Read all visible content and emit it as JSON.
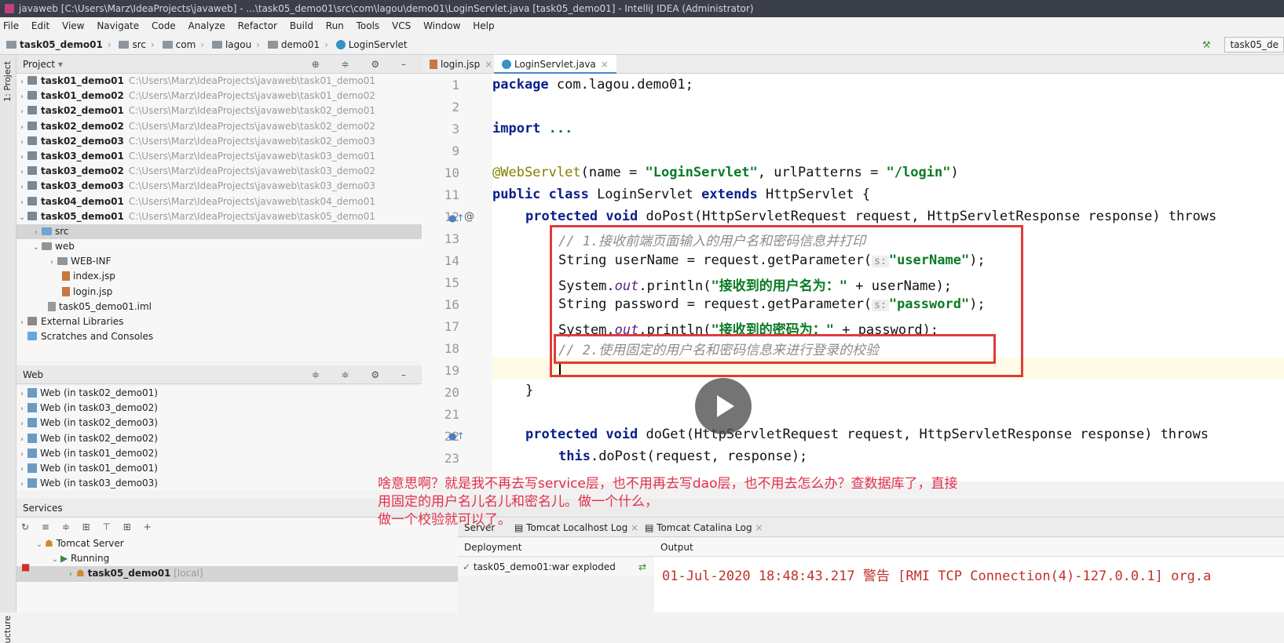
{
  "window": {
    "title": "javaweb [C:\\Users\\Marz\\IdeaProjects\\javaweb] - ...\\task05_demo01\\src\\com\\lagou\\demo01\\LoginServlet.java [task05_demo01] - IntelliJ IDEA (Administrator)"
  },
  "menu": [
    "File",
    "Edit",
    "View",
    "Navigate",
    "Code",
    "Analyze",
    "Refactor",
    "Build",
    "Run",
    "Tools",
    "VCS",
    "Window",
    "Help"
  ],
  "breadcrumbs": [
    "task05_demo01",
    "src",
    "com",
    "lagou",
    "demo01",
    "LoginServlet"
  ],
  "run_config": "task05_de",
  "side_strip": {
    "project": "1: Project",
    "structure": "ucture"
  },
  "project_panel": {
    "title": "Project",
    "modules": [
      {
        "name": "task01_demo01",
        "path": "C:\\Users\\Marz\\IdeaProjects\\javaweb\\task01_demo01"
      },
      {
        "name": "task01_demo02",
        "path": "C:\\Users\\Marz\\IdeaProjects\\javaweb\\task01_demo02"
      },
      {
        "name": "task02_demo01",
        "path": "C:\\Users\\Marz\\IdeaProjects\\javaweb\\task02_demo01"
      },
      {
        "name": "task02_demo02",
        "path": "C:\\Users\\Marz\\IdeaProjects\\javaweb\\task02_demo02"
      },
      {
        "name": "task02_demo03",
        "path": "C:\\Users\\Marz\\IdeaProjects\\javaweb\\task02_demo03"
      },
      {
        "name": "task03_demo01",
        "path": "C:\\Users\\Marz\\IdeaProjects\\javaweb\\task03_demo01"
      },
      {
        "name": "task03_demo02",
        "path": "C:\\Users\\Marz\\IdeaProjects\\javaweb\\task03_demo02"
      },
      {
        "name": "task03_demo03",
        "path": "C:\\Users\\Marz\\IdeaProjects\\javaweb\\task03_demo03"
      },
      {
        "name": "task04_demo01",
        "path": "C:\\Users\\Marz\\IdeaProjects\\javaweb\\task04_demo01"
      },
      {
        "name": "task05_demo01",
        "path": "C:\\Users\\Marz\\IdeaProjects\\javaweb\\task05_demo01"
      }
    ],
    "children": {
      "src": "src",
      "web": "web",
      "webinf": "WEB-INF",
      "index": "index.jsp",
      "login": "login.jsp",
      "iml": "task05_demo01.iml",
      "libs": "External Libraries",
      "scratches": "Scratches and Consoles"
    }
  },
  "web_panel": {
    "title": "Web",
    "items": [
      "Web (in task02_demo01)",
      "Web (in task03_demo02)",
      "Web (in task02_demo03)",
      "Web (in task02_demo02)",
      "Web (in task01_demo02)",
      "Web (in task01_demo01)",
      "Web (in task03_demo03)"
    ]
  },
  "editor": {
    "tabs": [
      {
        "label": "login.jsp"
      },
      {
        "label": "LoginServlet.java"
      }
    ],
    "line_numbers": [
      "1",
      "2",
      "3",
      "9",
      "10",
      "11",
      "12",
      "13",
      "14",
      "15",
      "16",
      "17",
      "18",
      "19",
      "20",
      "21",
      "22",
      "23"
    ],
    "code": {
      "l1_kw": "package",
      "l1_rest": " com.lagou.demo01;",
      "l3_kw": "import",
      "l3_rest": " ...",
      "l10_ann": "@WebServlet",
      "l10_a": "(name = ",
      "l10_s1": "\"LoginServlet\"",
      "l10_b": ", urlPatterns = ",
      "l10_s2": "\"/login\"",
      "l10_c": ")",
      "l11_kw1": "public class",
      "l11_a": " LoginServlet ",
      "l11_kw2": "extends",
      "l11_b": " HttpServlet {",
      "l12_kw": "protected void",
      "l12_rest": " doPost(HttpServletRequest request, HttpServletResponse response) throws",
      "l13_cmt": "// 1.接收前端页面输入的用户名和密码信息并打印",
      "l14_a": "String userName = request.getParameter(",
      "l14_hint": "s:",
      "l14_s": "\"userName\"",
      "l14_b": ");",
      "l15_a": "System.",
      "l15_out": "out",
      "l15_b": ".println(",
      "l15_s": "\"接收到的用户名为：\"",
      "l15_c": " + userName);",
      "l16_a": "String password = request.getParameter(",
      "l16_hint": "s:",
      "l16_s": "\"password\"",
      "l16_b": ");",
      "l17_a": "System.",
      "l17_out": "out",
      "l17_b": ".println(",
      "l17_s": "\"接收到的密码为：\"",
      "l17_c": " + password);",
      "l18_cmt": "// 2.使用固定的用户名和密码信息来进行登录的校验",
      "l20": "}",
      "l22_kw": "protected void",
      "l22_rest": " doGet(HttpServletRequest request, HttpServletResponse response) throws",
      "l23_kw": "this",
      "l23_rest": ".doPost(request, response);"
    }
  },
  "subtitle": {
    "line1": "啥意思啊？就是我不再去写service层，也不用再去写dao层，也不用去怎么办？查数据库了，直接",
    "line2": "用固定的用户名儿名儿和密名儿。做一个什么，",
    "line3": "做一个校验就可以了。"
  },
  "services": {
    "title": "Services",
    "tomcat": "Tomcat Server",
    "running": "Running",
    "app": "task05_demo01",
    "app_tag": "[local]",
    "tabs": [
      "Server",
      "Tomcat Localhost Log",
      "Tomcat Catalina Log"
    ],
    "deployment_label": "Deployment",
    "output_label": "Output",
    "deployment_item": "task05_demo01:war exploded",
    "output_line": "01-Jul-2020 18:48:43.217 警告 [RMI TCP Connection(4)-127.0.0.1] org.a"
  }
}
